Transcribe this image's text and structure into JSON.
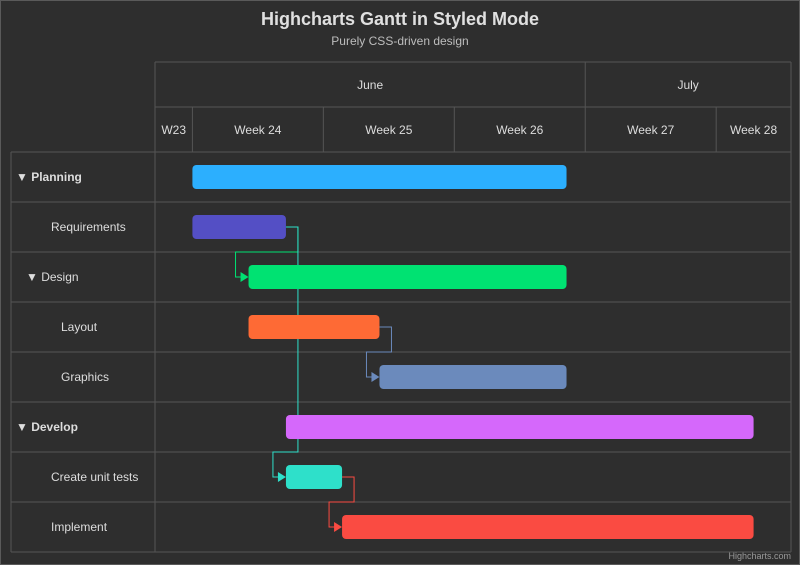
{
  "chart_data": {
    "type": "gantt",
    "title": "Highcharts Gantt in Styled Mode",
    "subtitle": "Purely CSS-driven design",
    "credits": "Highcharts.com",
    "x_unit": "days from start of Week 24",
    "xlim": [
      -2,
      32
    ],
    "months": [
      {
        "label": "June",
        "start": -2,
        "end": 21
      },
      {
        "label": "July",
        "start": 21,
        "end": 32
      }
    ],
    "weeks": [
      {
        "label": "W23",
        "start": -2,
        "end": 0
      },
      {
        "label": "Week 24",
        "start": 0,
        "end": 7
      },
      {
        "label": "Week 25",
        "start": 7,
        "end": 14
      },
      {
        "label": "Week 26",
        "start": 14,
        "end": 21
      },
      {
        "label": "Week 27",
        "start": 21,
        "end": 28
      },
      {
        "label": "Week 28",
        "start": 28,
        "end": 32
      }
    ],
    "tasks": [
      {
        "id": "planning",
        "name": "Planning",
        "level": 0,
        "collapsible": true,
        "start": 0,
        "end": 20,
        "color": "#2caffe"
      },
      {
        "id": "requirements",
        "name": "Requirements",
        "level": 1,
        "start": 0,
        "end": 5,
        "color": "#544fc5"
      },
      {
        "id": "design",
        "name": "Design",
        "level": 1,
        "collapsible": true,
        "start": 3,
        "end": 20,
        "color": "#00e272",
        "dependency": "requirements"
      },
      {
        "id": "layout",
        "name": "Layout",
        "level": 2,
        "start": 3,
        "end": 10,
        "color": "#fe6a35"
      },
      {
        "id": "graphics",
        "name": "Graphics",
        "level": 2,
        "start": 10,
        "end": 20,
        "color": "#6b8abc",
        "dependency": "layout"
      },
      {
        "id": "develop",
        "name": "Develop",
        "level": 0,
        "collapsible": true,
        "start": 5,
        "end": 30,
        "color": "#d568fb"
      },
      {
        "id": "unit",
        "name": "Create unit tests",
        "level": 1,
        "start": 5,
        "end": 8,
        "color": "#2ee0ca",
        "dependency": "requirements"
      },
      {
        "id": "implement",
        "name": "Implement",
        "level": 1,
        "start": 8,
        "end": 30,
        "color": "#fa4b42",
        "dependency": "unit"
      }
    ],
    "collapse_glyph": "▼"
  }
}
